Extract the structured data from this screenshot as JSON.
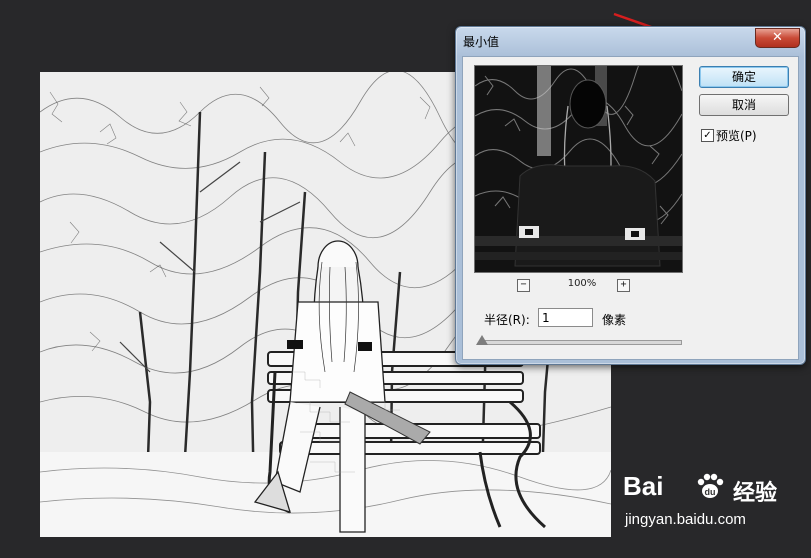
{
  "dialog": {
    "title": "最小值",
    "close_glyph": "✕",
    "ok_label": "确定",
    "cancel_label": "取消",
    "preview_check_glyph": "✓",
    "preview_label": "预览(P)",
    "preview_checked": true,
    "zoom_out_glyph": "−",
    "zoom_in_glyph": "+",
    "zoom_level": "100%",
    "radius_label": "半径(R):",
    "radius_value": "1",
    "radius_unit": "像素"
  },
  "watermark": {
    "logo_text": "Bai",
    "suffix_text": "经验",
    "url": "jingyan.baidu.com"
  },
  "colors": {
    "workspace_bg": "#28282a",
    "dialog_frame": "#aabfd8",
    "close_button": "#c94a36",
    "arrow": "#d81e1e"
  },
  "icons": [
    "close-icon",
    "zoom-out-icon",
    "zoom-in-icon",
    "checkbox-check-icon",
    "slider-thumb-icon",
    "annotation-arrow",
    "baidu-paw-icon"
  ]
}
